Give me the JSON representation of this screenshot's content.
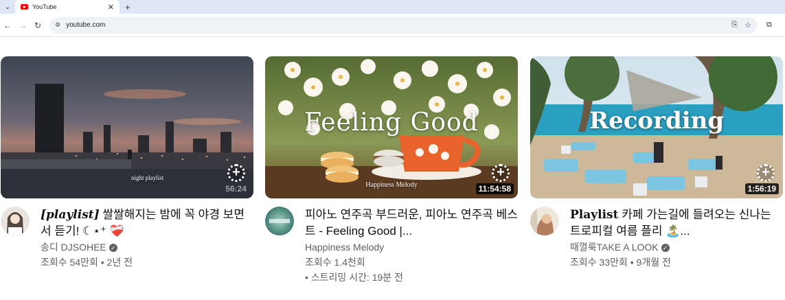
{
  "browser": {
    "tab_title": "YouTube",
    "tab_close": "✕",
    "new_tab": "+",
    "url": "youtube.com"
  },
  "videos": [
    {
      "title_prefix": "[playlist]",
      "title_rest": " 쌀쌀해지는 밤에 꼭 야경 보면서 듣기! ☾⋆⁺ ❤️‍🩹",
      "channel": "송디 DJSOHEE",
      "verified": true,
      "views": "조회수 54만회",
      "age": "2년 전",
      "stats": "조회수 54만회 • 2년 전",
      "duration": "56:24",
      "thumb_caption": "night playlist"
    },
    {
      "title": "피아노 연주곡 부드러운, 피아노 연주곡 베스트 - Feeling Good |...",
      "channel": "Happiness Melody",
      "verified": false,
      "views": "조회수 1.4천회",
      "streamed": "• 스트리밍 시간: 19분 전",
      "duration": "11:54:58",
      "thumb_title": "Feeling Good",
      "thumb_caption": "Happiness Melody"
    },
    {
      "title_prefix": "Playlist",
      "title_rest": " 카페 가는길에 들려오는 신나는 트로피컬 여름 플리 🏝️...",
      "channel": "때껄룩TAKE A LOOK",
      "verified": true,
      "views": "조회수 33만회",
      "age": "9개월 전",
      "stats": "조회수 33만회 • 9개월 전",
      "duration": "1:56:19",
      "thumb_title": "Recording"
    }
  ],
  "colors": {
    "tabbar_bg": "#dfe7f6",
    "omnibox_bg": "#eef2f9",
    "title_text": "#0f0f0f",
    "meta_text": "#606060"
  }
}
